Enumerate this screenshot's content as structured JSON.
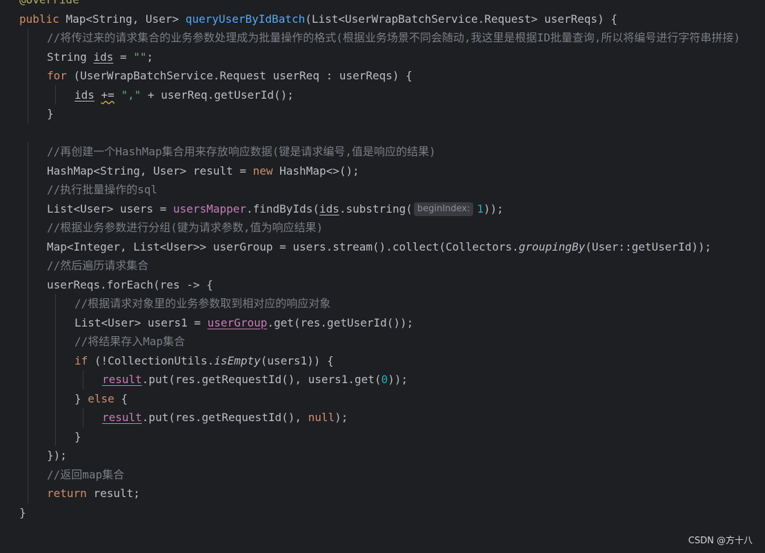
{
  "editor": {
    "lines": [
      {
        "indent": 0,
        "tokens": [
          {
            "t": "@Override",
            "c": "ann"
          }
        ]
      },
      {
        "indent": 0,
        "tokens": [
          {
            "t": "public ",
            "c": "kw"
          },
          {
            "t": "Map<String, User> "
          },
          {
            "t": "queryUserByIdBatch",
            "c": "fn"
          },
          {
            "t": "(List<UserWrapBatchService.Request> userReqs) {"
          }
        ]
      },
      {
        "indent": 1,
        "tokens": [
          {
            "t": "//将传过来的请求集合的业务参数处理成为批量操作的格式(根据业务场景不同会随动,我这里是根据ID批量查询,所以将编号进行字符串拼接)",
            "c": "cm"
          }
        ]
      },
      {
        "indent": 1,
        "tokens": [
          {
            "t": "String "
          },
          {
            "t": "ids",
            "c": "ul"
          },
          {
            "t": " = "
          },
          {
            "t": "\"\"",
            "c": "str"
          },
          {
            "t": ";"
          }
        ]
      },
      {
        "indent": 1,
        "tokens": [
          {
            "t": "for ",
            "c": "kw"
          },
          {
            "t": "(UserWrapBatchService.Request userReq : userReqs) {"
          }
        ]
      },
      {
        "indent": 2,
        "tokens": [
          {
            "t": "ids",
            "c": "ul"
          },
          {
            "t": " "
          },
          {
            "t": "+=",
            "c": "wavy"
          },
          {
            "t": " "
          },
          {
            "t": "\",\"",
            "c": "str"
          },
          {
            "t": " + userReq.getUserId();"
          }
        ]
      },
      {
        "indent": 1,
        "tokens": [
          {
            "t": "}"
          }
        ]
      },
      {
        "indent": 0,
        "tokens": []
      },
      {
        "indent": 1,
        "tokens": [
          {
            "t": "//再创建一个HashMap集合用来存放响应数据(键是请求编号,值是响应的结果)",
            "c": "cm"
          }
        ]
      },
      {
        "indent": 1,
        "tokens": [
          {
            "t": "HashMap<String, User> result = "
          },
          {
            "t": "new ",
            "c": "kw"
          },
          {
            "t": "HashMap<>();"
          }
        ]
      },
      {
        "indent": 1,
        "tokens": [
          {
            "t": "//执行批量操作的sql",
            "c": "cm"
          }
        ]
      },
      {
        "indent": 1,
        "tokens": [
          {
            "t": "List<User> users = "
          },
          {
            "t": "usersMapper",
            "c": "fld"
          },
          {
            "t": ".findByIds("
          },
          {
            "t": "ids",
            "c": "ul"
          },
          {
            "t": ".substring("
          },
          {
            "t": "beginIndex:",
            "c": "hint"
          },
          {
            "t": "1",
            "c": "num"
          },
          {
            "t": "));"
          }
        ]
      },
      {
        "indent": 1,
        "tokens": [
          {
            "t": "//根据业务参数进行分组(键为请求参数,值为响应结果)",
            "c": "cm"
          }
        ]
      },
      {
        "indent": 1,
        "tokens": [
          {
            "t": "Map<Integer, List<User>> userGroup = users.stream().collect(Collectors."
          },
          {
            "t": "groupingBy",
            "c": "it"
          },
          {
            "t": "(User::getUserId));"
          }
        ]
      },
      {
        "indent": 1,
        "tokens": [
          {
            "t": "//然后遍历请求集合",
            "c": "cm"
          }
        ]
      },
      {
        "indent": 1,
        "tokens": [
          {
            "t": "userReqs.forEach(res -> {"
          }
        ]
      },
      {
        "indent": 2,
        "tokens": [
          {
            "t": "//根据请求对象里的业务参数取到相对应的响应对象",
            "c": "cm"
          }
        ]
      },
      {
        "indent": 2,
        "tokens": [
          {
            "t": "List<User> users1 = "
          },
          {
            "t": "userGroup",
            "c": "fld ul-fld"
          },
          {
            "t": ".get(res.getUserId());"
          }
        ]
      },
      {
        "indent": 2,
        "tokens": [
          {
            "t": "//将结果存入Map集合",
            "c": "cm"
          }
        ]
      },
      {
        "indent": 2,
        "tokens": [
          {
            "t": "if ",
            "c": "kw"
          },
          {
            "t": "(!CollectionUtils."
          },
          {
            "t": "isEmpty",
            "c": "it"
          },
          {
            "t": "(users1)) {"
          }
        ]
      },
      {
        "indent": 3,
        "tokens": [
          {
            "t": "result",
            "c": "fld ul-fld"
          },
          {
            "t": ".put(res.getRequestId(), users1.get("
          },
          {
            "t": "0",
            "c": "num"
          },
          {
            "t": "));"
          }
        ]
      },
      {
        "indent": 2,
        "tokens": [
          {
            "t": "} "
          },
          {
            "t": "else ",
            "c": "kw"
          },
          {
            "t": "{"
          }
        ]
      },
      {
        "indent": 3,
        "tokens": [
          {
            "t": "result",
            "c": "fld ul-fld"
          },
          {
            "t": ".put(res.getRequestId(), "
          },
          {
            "t": "null",
            "c": "kw"
          },
          {
            "t": ");"
          }
        ]
      },
      {
        "indent": 2,
        "tokens": [
          {
            "t": "}"
          }
        ]
      },
      {
        "indent": 1,
        "tokens": [
          {
            "t": "});"
          }
        ]
      },
      {
        "indent": 1,
        "tokens": [
          {
            "t": "//返回map集合",
            "c": "cm"
          }
        ]
      },
      {
        "indent": 1,
        "tokens": [
          {
            "t": "return ",
            "c": "kw"
          },
          {
            "t": "result;"
          }
        ]
      },
      {
        "indent": 0,
        "tokens": [
          {
            "t": "}"
          }
        ]
      }
    ]
  },
  "watermark": "CSDN @方十八",
  "colors": {
    "background": "#1e1f22",
    "text": "#bcbec4",
    "keyword": "#cf8e6d",
    "method": "#56a8f5",
    "comment": "#7a7e85",
    "string": "#6aab73",
    "number": "#2aacb8",
    "field": "#c77dbb",
    "annotation": "#b3ae60"
  }
}
